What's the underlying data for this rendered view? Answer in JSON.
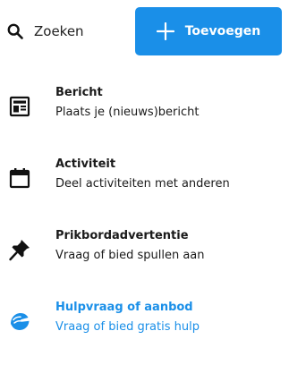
{
  "colors": {
    "accent": "#1a8fe8",
    "text": "#1a1a1a"
  },
  "header": {
    "search_label": "Zoeken",
    "add_label": "Toevoegen"
  },
  "menu": {
    "items": [
      {
        "icon": "article-icon",
        "title": "Bericht",
        "subtitle": "Plaats je (nieuws)bericht"
      },
      {
        "icon": "calendar-icon",
        "title": "Activiteit",
        "subtitle": "Deel activiteiten met anderen"
      },
      {
        "icon": "pushpin-icon",
        "title": "Prikbordadvertentie",
        "subtitle": "Vraag of bied spullen aan"
      },
      {
        "icon": "helping-hand-icon",
        "title": "Hulpvraag of aanbod",
        "subtitle": "Vraag of bied gratis hulp",
        "active": true
      }
    ]
  }
}
